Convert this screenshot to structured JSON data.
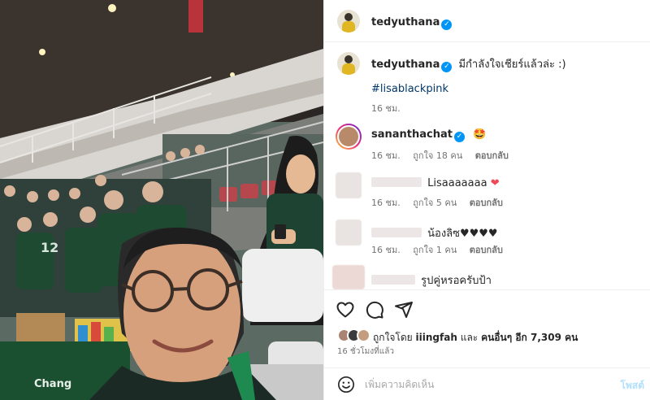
{
  "post": {
    "owner": "tedyuthana",
    "verified_icon": "verified-badge-icon",
    "caption": "มีกำลังใจเชียร์แล้วล่ะ :)",
    "hashtag": "#lisablackpink",
    "caption_time": "16 ชม."
  },
  "comments": [
    {
      "user": "sananthachat",
      "verified": true,
      "text": "🤩",
      "time": "16 ชม.",
      "likes": "ถูกใจ 18 คน",
      "reply": "ตอบกลับ"
    },
    {
      "user": "",
      "text": "Lisaaaaaaa",
      "emoji": "❤",
      "time": "16 ชม.",
      "likes": "ถูกใจ 5 คน",
      "reply": "ตอบกลับ"
    },
    {
      "user": "",
      "text": "น้องลิซ♥♥♥♥",
      "time": "16 ชม.",
      "likes": "ถูกใจ 1 คน",
      "reply": "ตอบกลับ"
    },
    {
      "user": "",
      "text": "รูปคู่หรอครับป้า"
    }
  ],
  "likes": {
    "prefix": "ถูกใจโดย",
    "user": "iiingfah",
    "middle": "และ",
    "others_label": "คนอื่นๆ อีก 7,309 คน"
  },
  "timestamp": "16 ชั่วโมงที่แล้ว",
  "add_comment": {
    "placeholder": "เพิ่มความคิดเห็น",
    "post_label": "โพสต์"
  },
  "icons": {
    "like": "heart-outline-icon",
    "comment": "comment-bubble-icon",
    "share": "paper-plane-icon",
    "emoji": "smiley-face-icon"
  },
  "colors": {
    "verified": "#0095f6",
    "hashtag": "#00376b",
    "heart": "#ed4956",
    "muted": "#737373"
  }
}
